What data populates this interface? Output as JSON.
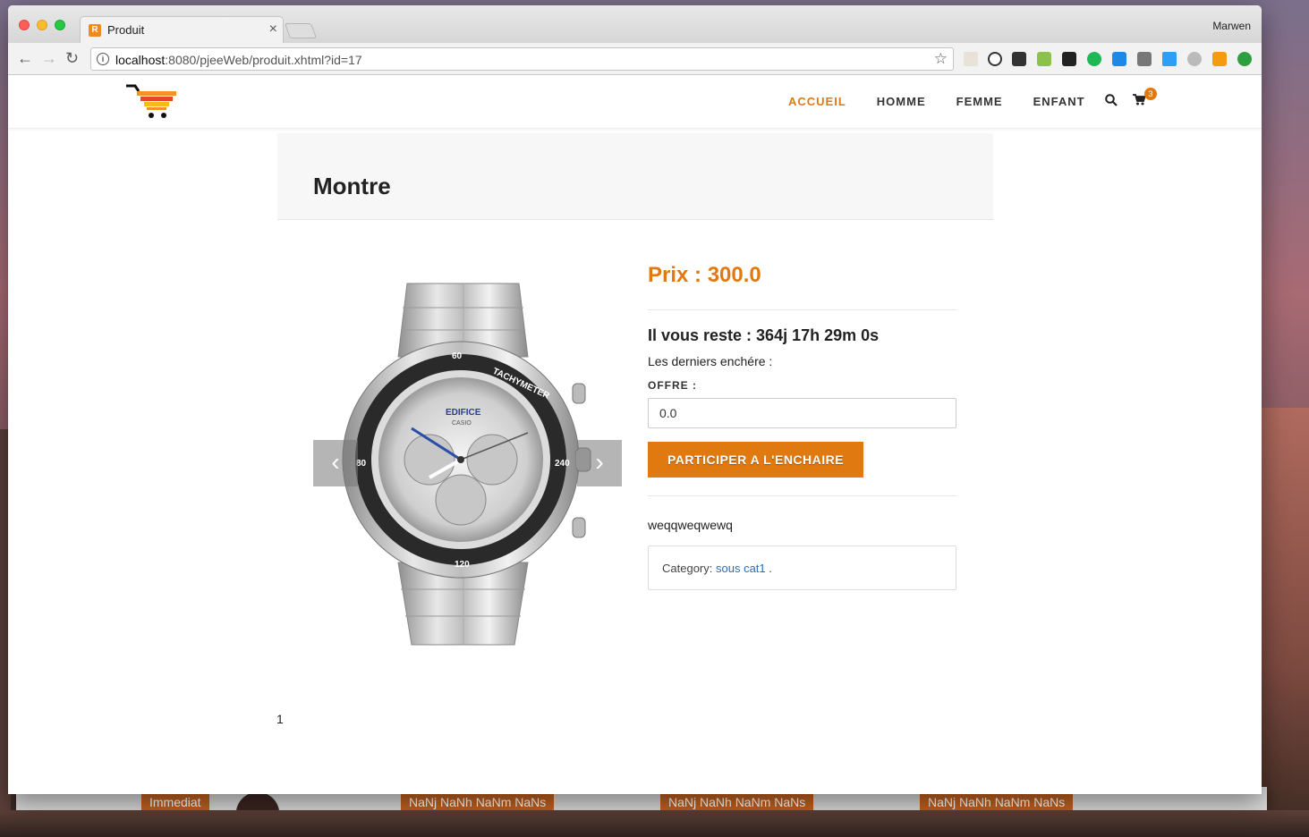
{
  "browser": {
    "tab_title": "Produit",
    "tab_favicon": "R",
    "user_name": "Marwen",
    "url_host": "localhost",
    "url_rest": ":8080/pjeeWeb/produit.xhtml?id=17"
  },
  "site": {
    "nav": [
      {
        "label": "ACCUEIL",
        "active": true
      },
      {
        "label": "HOMME",
        "active": false
      },
      {
        "label": "FEMME",
        "active": false
      },
      {
        "label": "ENFANT",
        "active": false
      }
    ],
    "cart_count": "3"
  },
  "product": {
    "title": "Montre",
    "price": "Prix : 300.0",
    "countdown": "Il vous reste : 364j 17h 29m 0s",
    "last_bids_label": "Les derniers enchére :",
    "offer_label": "OFFRE :",
    "offer_value": "0.0",
    "bid_button": "PARTICIPER A L'ENCHAIRE",
    "description": "weqqweqwewq",
    "category_label": "Category:",
    "category_value": "sous cat1",
    "category_suffix": "."
  },
  "gallery": {
    "prev_icon": "chevron-left-icon",
    "next_icon": "chevron-right-icon",
    "watch_brand": "EDIFICE",
    "watch_sub": "CASIO",
    "bezel_label": "TACHYMETER"
  },
  "pager": {
    "current": "1"
  },
  "background_window": {
    "labels": [
      "Immediat",
      "NaNj NaNh NaNm NaNs",
      "NaNj NaNh NaNm NaNs",
      "NaNj NaNh NaNm NaNs"
    ]
  },
  "colors": {
    "accent": "#e07a10",
    "link": "#2a6cb3"
  }
}
